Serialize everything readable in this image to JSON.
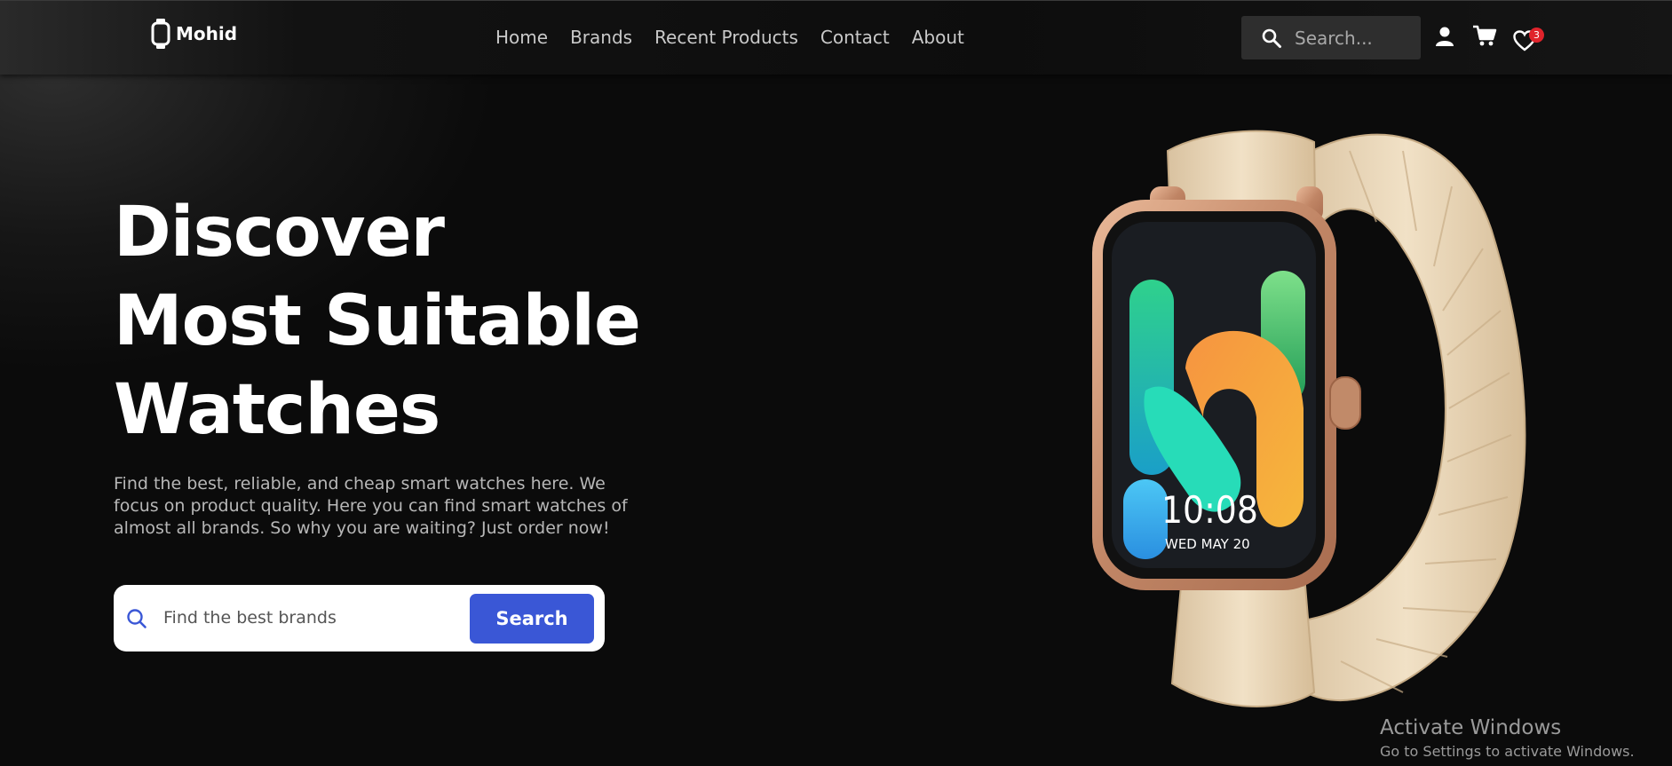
{
  "brand": {
    "name": "Mohid",
    "icon": "smartwatch-icon"
  },
  "nav": {
    "links": [
      "Home",
      "Brands",
      "Recent Products",
      "Contact",
      "About"
    ],
    "search_placeholder": "Search...",
    "wishlist_count": "3",
    "icons": [
      "search-icon",
      "user-icon",
      "cart-icon",
      "heart-icon"
    ]
  },
  "hero": {
    "title_lines": [
      "Discover",
      "Most Suitable",
      "Watches"
    ],
    "description": "Find the best, reliable, and cheap smart watches here. We focus on product quality. Here you can find smart watches of almost all brands. So why you are waiting? Just order now!",
    "search_placeholder": "Find the best brands",
    "search_button": "Search"
  },
  "watch": {
    "time": "10:08",
    "date": "WED  MAY 20"
  },
  "os_notice": {
    "title": "Activate Windows",
    "subtitle": "Go to Settings to activate Windows."
  },
  "colors": {
    "accent": "#3a57d6",
    "badge": "#e0232b",
    "background": "#0b0b0b",
    "band": "#e9d6b8",
    "case": "#c8906e"
  }
}
